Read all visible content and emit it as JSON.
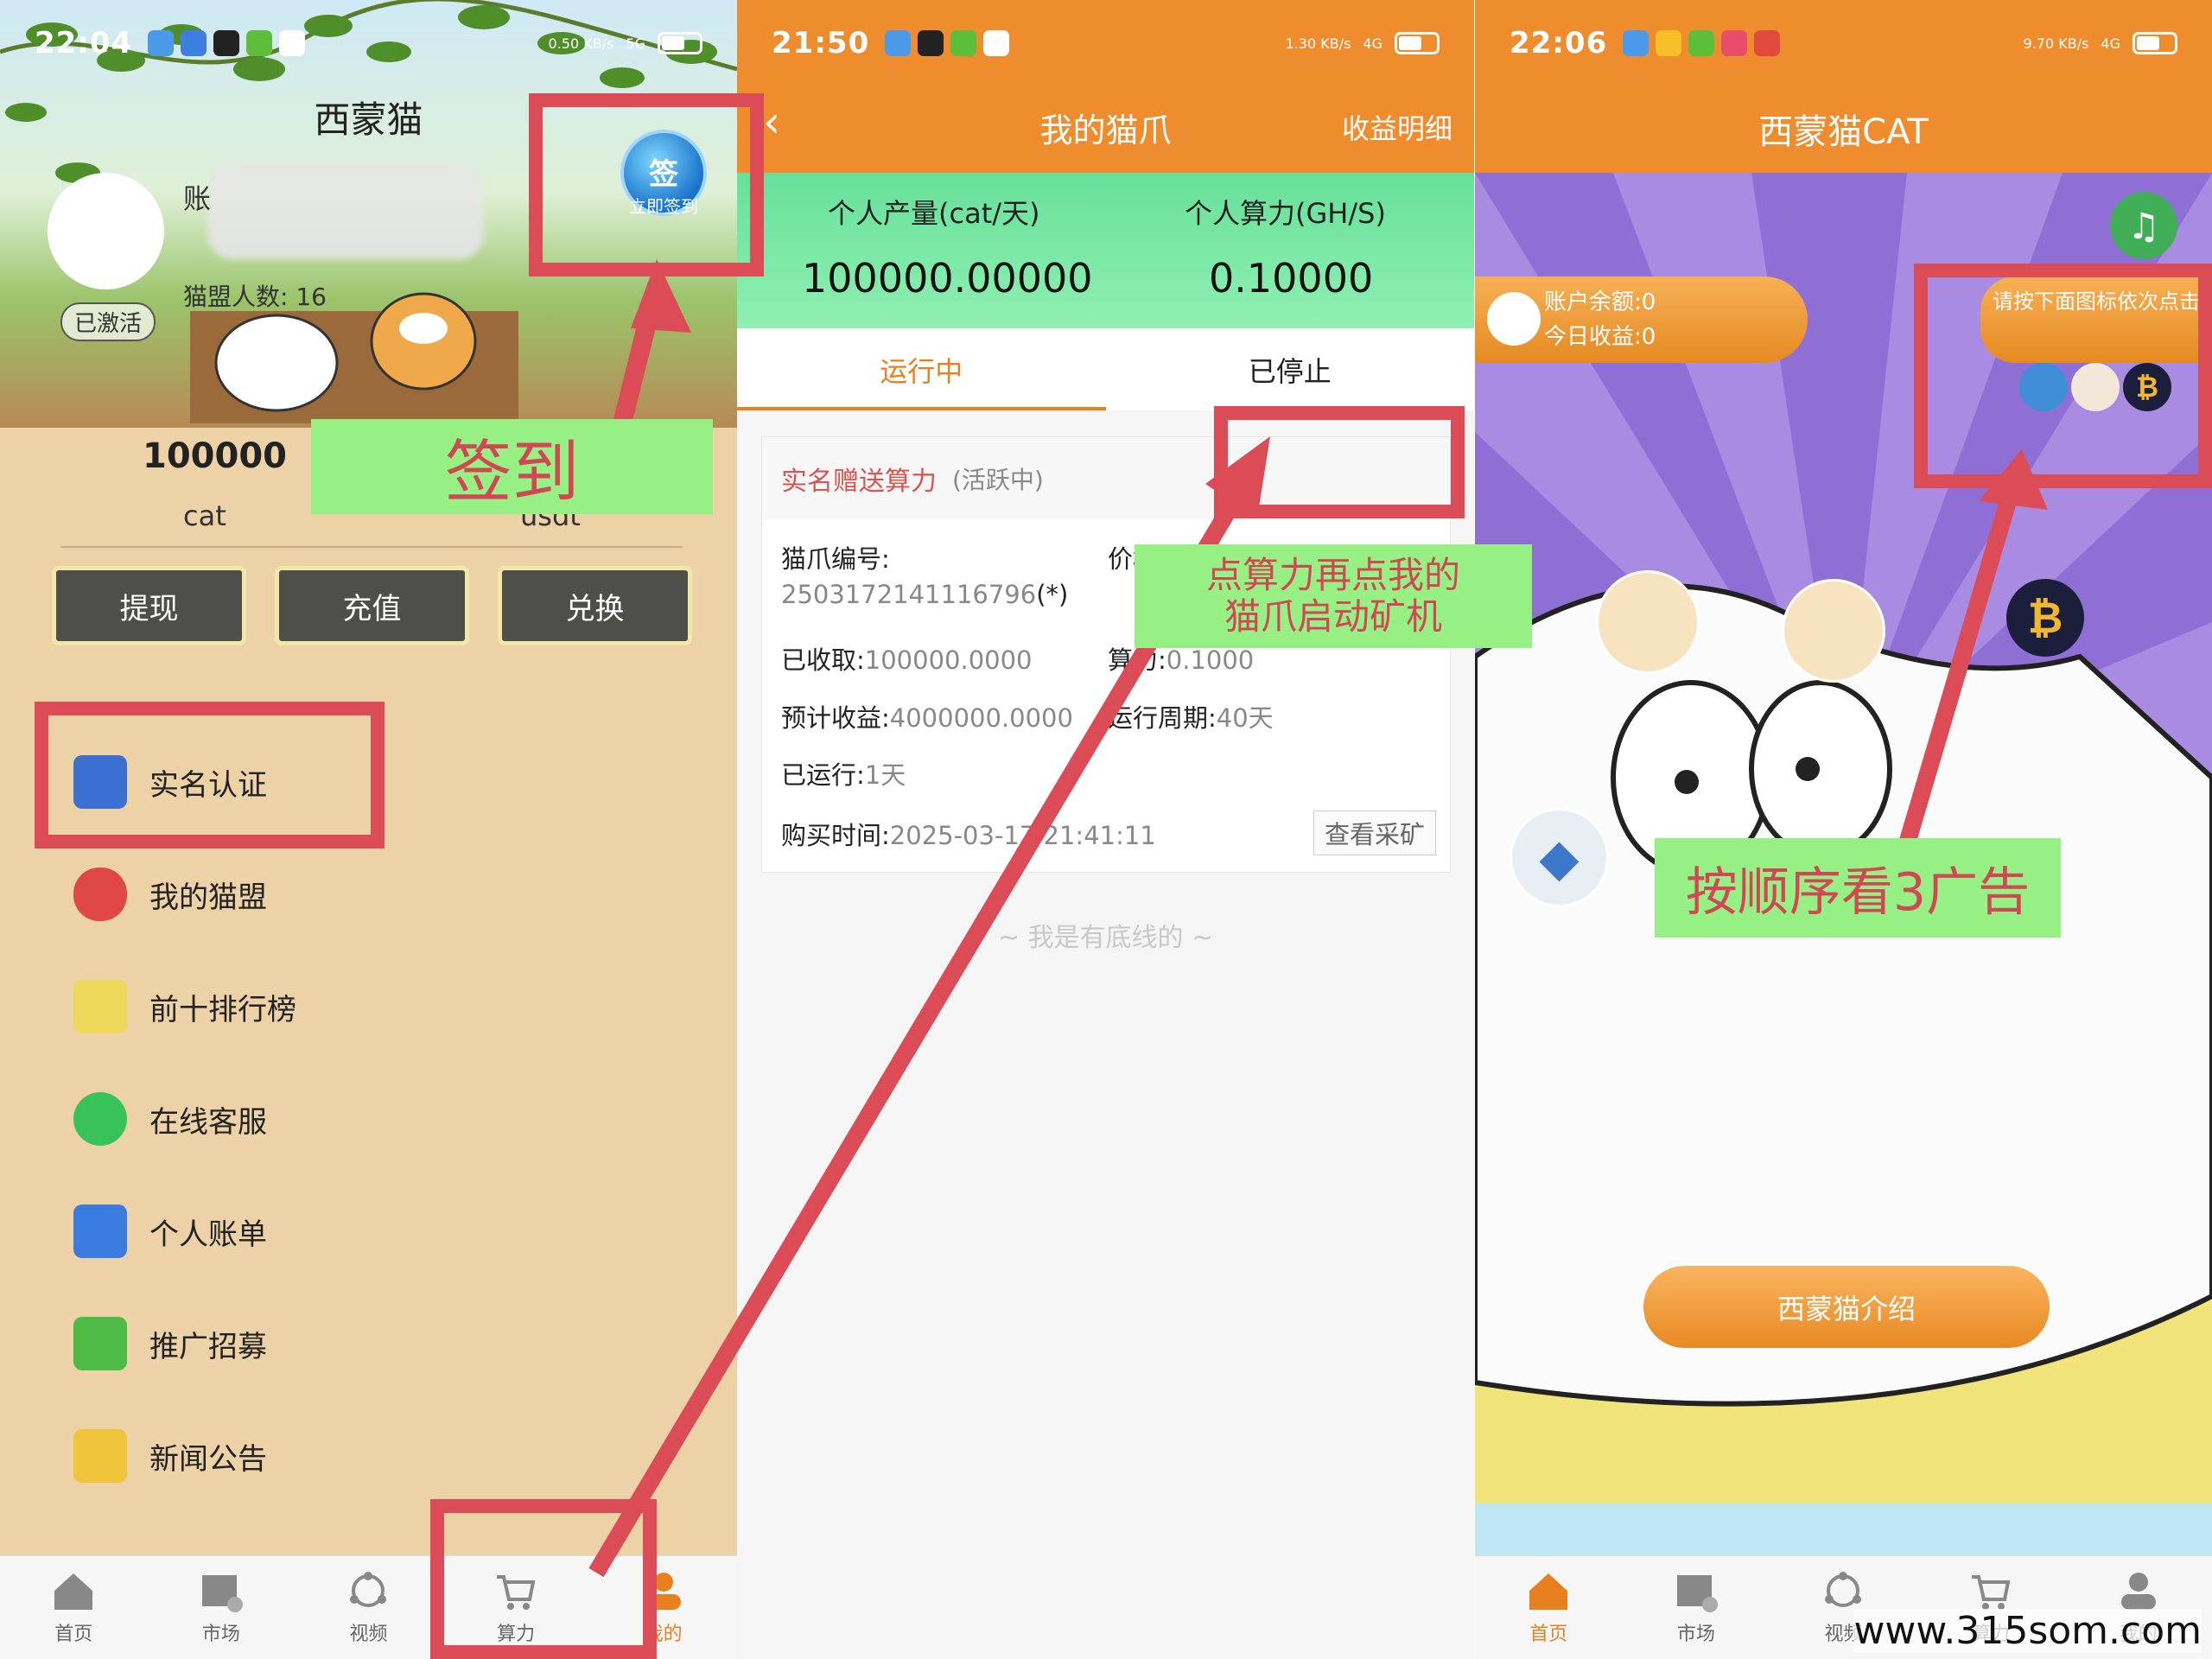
{
  "panel1": {
    "status": {
      "time": "22:04",
      "speed": "0.50 KB/s",
      "net": "5G"
    },
    "title": "西蒙猫",
    "account_prefix": "账",
    "league_count": "猫盟人数: 16",
    "activated": "已激活",
    "sign_in": {
      "label": "签",
      "sub": "立即签到"
    },
    "balances": [
      {
        "value": "100000",
        "unit": "cat"
      },
      {
        "value": "",
        "unit": "usdt"
      }
    ],
    "buttons": [
      "提现",
      "充值",
      "兑换"
    ],
    "menu": [
      "实名认证",
      "我的猫盟",
      "前十排行榜",
      "在线客服",
      "个人账单",
      "推广招募",
      "新闻公告"
    ],
    "menu_icon_colors": [
      "#3b6fd1",
      "#e04848",
      "#efd95a",
      "#37c25a",
      "#3b7be0",
      "#4fbb47",
      "#f0c43b"
    ],
    "tabs": [
      "首页",
      "市场",
      "视频",
      "算力",
      "我的"
    ],
    "active_tab": 4
  },
  "panel2": {
    "status": {
      "time": "21:50",
      "speed": "1.30 KB/s",
      "net": "4G"
    },
    "title": "我的猫爪",
    "right_link": "收益明细",
    "stats": [
      {
        "label": "个人产量(cat/天)",
        "value": "100000.00000"
      },
      {
        "label": "个人算力(GH/S)",
        "value": "0.10000"
      }
    ],
    "tabs": [
      "运行中",
      "已停止"
    ],
    "card": {
      "title": "实名赠送算力",
      "status": "(活跃中)",
      "id_label": "猫爪编号:",
      "id_value": "2503172141116796",
      "id_suffix": "(*)",
      "price_label": "价格",
      "received_label": "已收取:",
      "received_value": "100000.0000",
      "power_label": "算力:",
      "power_value": "0.1000",
      "expected_label": "预计收益:",
      "expected_value": "4000000.0000",
      "cycle_label": "运行周期:",
      "cycle_value": "40天",
      "ran_label": "已运行:",
      "ran_value": "1天",
      "buy_label": "购买时间:",
      "buy_value": "2025-03-17 21:41:11",
      "view_button": "查看采矿"
    },
    "footer": "~ 我是有底线的 ~"
  },
  "panel3": {
    "status": {
      "time": "22:06",
      "speed": "9.70 KB/s",
      "net": "4G"
    },
    "title": "西蒙猫CAT",
    "balance": "账户余额:0",
    "today": "今日收益:0",
    "hint": "请按下面图标依次点击",
    "intro_button": "西蒙猫介绍",
    "tabs": [
      "首页",
      "市场",
      "视频",
      "算力",
      "我的"
    ],
    "active_tab": 0
  },
  "annotations": {
    "sign_label": "签到",
    "mine_label_line1": "点算力再点我的",
    "mine_label_line2": "猫爪启动矿机",
    "ads_label": "按顺序看3广告",
    "color": "#dc4c57"
  },
  "watermark": "www.315som.com",
  "colors": {
    "orange": "#ef8d2e",
    "green": "#67e09a",
    "red_annotation": "#dc4c57",
    "label_green": "#97f083"
  }
}
